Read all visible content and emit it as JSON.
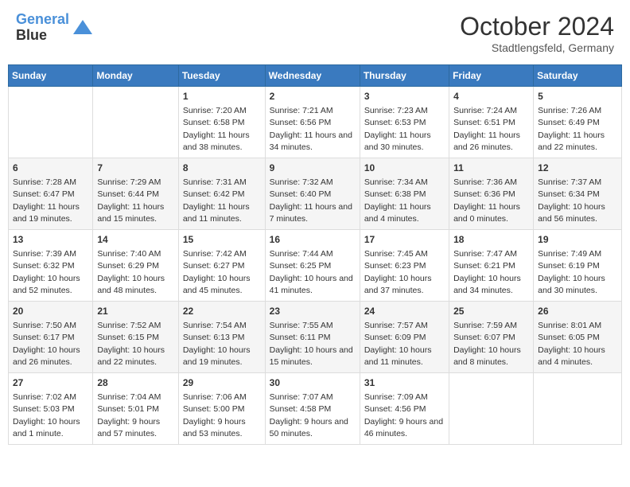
{
  "header": {
    "logo_line1": "General",
    "logo_line2": "Blue",
    "month": "October 2024",
    "location": "Stadtlengsfeld, Germany"
  },
  "weekdays": [
    "Sunday",
    "Monday",
    "Tuesday",
    "Wednesday",
    "Thursday",
    "Friday",
    "Saturday"
  ],
  "weeks": [
    [
      {
        "day": "",
        "info": ""
      },
      {
        "day": "",
        "info": ""
      },
      {
        "day": "1",
        "info": "Sunrise: 7:20 AM\nSunset: 6:58 PM\nDaylight: 11 hours and 38 minutes."
      },
      {
        "day": "2",
        "info": "Sunrise: 7:21 AM\nSunset: 6:56 PM\nDaylight: 11 hours and 34 minutes."
      },
      {
        "day": "3",
        "info": "Sunrise: 7:23 AM\nSunset: 6:53 PM\nDaylight: 11 hours and 30 minutes."
      },
      {
        "day": "4",
        "info": "Sunrise: 7:24 AM\nSunset: 6:51 PM\nDaylight: 11 hours and 26 minutes."
      },
      {
        "day": "5",
        "info": "Sunrise: 7:26 AM\nSunset: 6:49 PM\nDaylight: 11 hours and 22 minutes."
      }
    ],
    [
      {
        "day": "6",
        "info": "Sunrise: 7:28 AM\nSunset: 6:47 PM\nDaylight: 11 hours and 19 minutes."
      },
      {
        "day": "7",
        "info": "Sunrise: 7:29 AM\nSunset: 6:44 PM\nDaylight: 11 hours and 15 minutes."
      },
      {
        "day": "8",
        "info": "Sunrise: 7:31 AM\nSunset: 6:42 PM\nDaylight: 11 hours and 11 minutes."
      },
      {
        "day": "9",
        "info": "Sunrise: 7:32 AM\nSunset: 6:40 PM\nDaylight: 11 hours and 7 minutes."
      },
      {
        "day": "10",
        "info": "Sunrise: 7:34 AM\nSunset: 6:38 PM\nDaylight: 11 hours and 4 minutes."
      },
      {
        "day": "11",
        "info": "Sunrise: 7:36 AM\nSunset: 6:36 PM\nDaylight: 11 hours and 0 minutes."
      },
      {
        "day": "12",
        "info": "Sunrise: 7:37 AM\nSunset: 6:34 PM\nDaylight: 10 hours and 56 minutes."
      }
    ],
    [
      {
        "day": "13",
        "info": "Sunrise: 7:39 AM\nSunset: 6:32 PM\nDaylight: 10 hours and 52 minutes."
      },
      {
        "day": "14",
        "info": "Sunrise: 7:40 AM\nSunset: 6:29 PM\nDaylight: 10 hours and 48 minutes."
      },
      {
        "day": "15",
        "info": "Sunrise: 7:42 AM\nSunset: 6:27 PM\nDaylight: 10 hours and 45 minutes."
      },
      {
        "day": "16",
        "info": "Sunrise: 7:44 AM\nSunset: 6:25 PM\nDaylight: 10 hours and 41 minutes."
      },
      {
        "day": "17",
        "info": "Sunrise: 7:45 AM\nSunset: 6:23 PM\nDaylight: 10 hours and 37 minutes."
      },
      {
        "day": "18",
        "info": "Sunrise: 7:47 AM\nSunset: 6:21 PM\nDaylight: 10 hours and 34 minutes."
      },
      {
        "day": "19",
        "info": "Sunrise: 7:49 AM\nSunset: 6:19 PM\nDaylight: 10 hours and 30 minutes."
      }
    ],
    [
      {
        "day": "20",
        "info": "Sunrise: 7:50 AM\nSunset: 6:17 PM\nDaylight: 10 hours and 26 minutes."
      },
      {
        "day": "21",
        "info": "Sunrise: 7:52 AM\nSunset: 6:15 PM\nDaylight: 10 hours and 22 minutes."
      },
      {
        "day": "22",
        "info": "Sunrise: 7:54 AM\nSunset: 6:13 PM\nDaylight: 10 hours and 19 minutes."
      },
      {
        "day": "23",
        "info": "Sunrise: 7:55 AM\nSunset: 6:11 PM\nDaylight: 10 hours and 15 minutes."
      },
      {
        "day": "24",
        "info": "Sunrise: 7:57 AM\nSunset: 6:09 PM\nDaylight: 10 hours and 11 minutes."
      },
      {
        "day": "25",
        "info": "Sunrise: 7:59 AM\nSunset: 6:07 PM\nDaylight: 10 hours and 8 minutes."
      },
      {
        "day": "26",
        "info": "Sunrise: 8:01 AM\nSunset: 6:05 PM\nDaylight: 10 hours and 4 minutes."
      }
    ],
    [
      {
        "day": "27",
        "info": "Sunrise: 7:02 AM\nSunset: 5:03 PM\nDaylight: 10 hours and 1 minute."
      },
      {
        "day": "28",
        "info": "Sunrise: 7:04 AM\nSunset: 5:01 PM\nDaylight: 9 hours and 57 minutes."
      },
      {
        "day": "29",
        "info": "Sunrise: 7:06 AM\nSunset: 5:00 PM\nDaylight: 9 hours and 53 minutes."
      },
      {
        "day": "30",
        "info": "Sunrise: 7:07 AM\nSunset: 4:58 PM\nDaylight: 9 hours and 50 minutes."
      },
      {
        "day": "31",
        "info": "Sunrise: 7:09 AM\nSunset: 4:56 PM\nDaylight: 9 hours and 46 minutes."
      },
      {
        "day": "",
        "info": ""
      },
      {
        "day": "",
        "info": ""
      }
    ]
  ]
}
